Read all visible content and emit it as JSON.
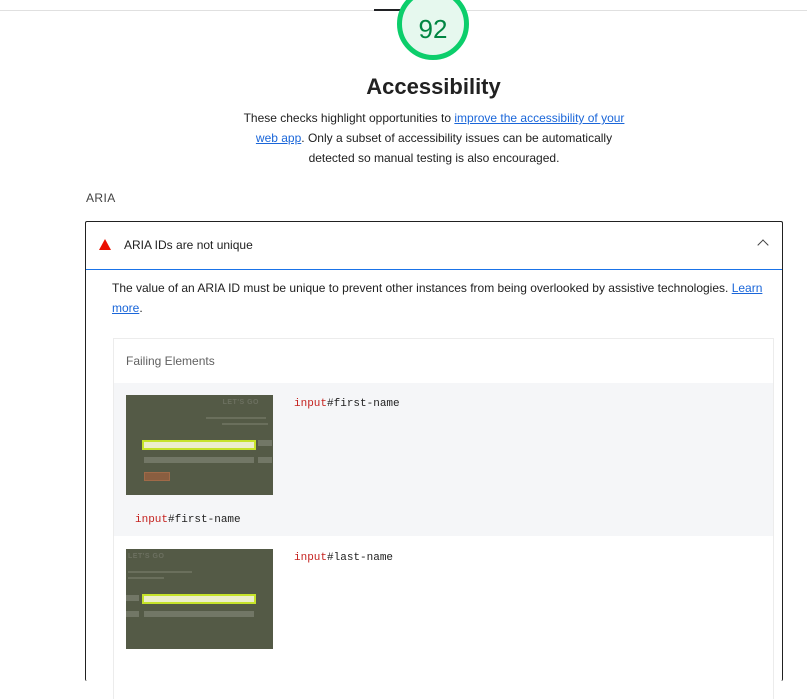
{
  "score": "92",
  "category": {
    "title": "Accessibility",
    "desc_prefix": "These checks highlight opportunities to ",
    "desc_link": "improve the accessibility of your web app",
    "desc_suffix": ". Only a subset of accessibility issues can be automatically detected so manual testing is also encouraged."
  },
  "group": {
    "title": "ARIA"
  },
  "audit": {
    "title": "ARIA IDs are not unique",
    "desc": "The value of an ARIA ID must be unique to prevent other instances from being overlooked by assistive technologies. ",
    "learn_more": "Learn more",
    "desc_end": ".",
    "details_header": "Failing Elements",
    "items": [
      {
        "tag": "input",
        "selector": "#first-name",
        "snippet_title": "LET'S GO"
      },
      {
        "tag": "input",
        "selector": "#last-name",
        "snippet_title": "LET'S GO"
      }
    ],
    "related_node": {
      "tag": "input",
      "selector": "#first-name"
    }
  },
  "colors": {
    "pass_green": "#0cce6b",
    "fail_red": "#eb0f00",
    "link_blue": "#1a66d9",
    "highlight": "#c6e32a"
  }
}
